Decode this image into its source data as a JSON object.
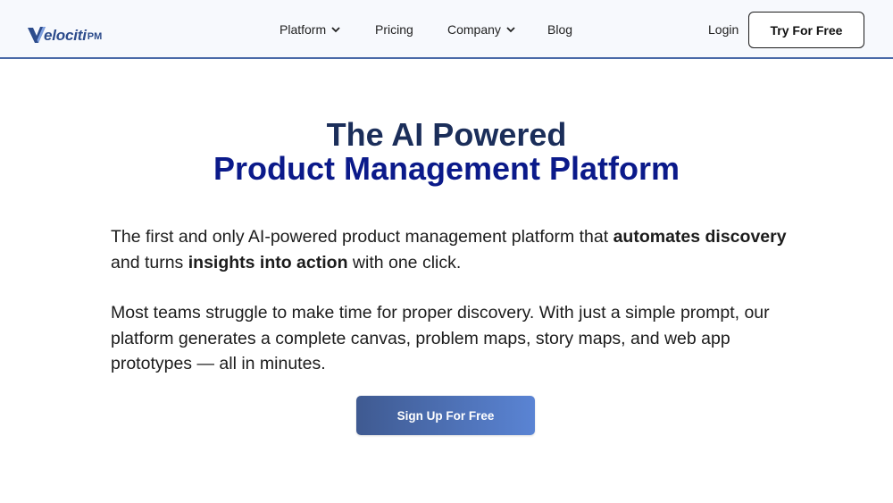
{
  "nav": {
    "logo_main": "elociti",
    "logo_suffix": "PM",
    "items": [
      {
        "label": "Platform",
        "has_dropdown": true
      },
      {
        "label": "Pricing",
        "has_dropdown": false
      },
      {
        "label": "Company",
        "has_dropdown": true
      },
      {
        "label": "Blog",
        "has_dropdown": false
      }
    ],
    "login": "Login",
    "cta": "Try For Free"
  },
  "hero": {
    "title_line1": "The AI Powered",
    "title_line2": "Product Management Platform",
    "p1": {
      "t1": "The first and only AI-powered product management platform that ",
      "b1": "automates discovery",
      "t2": " and turns ",
      "b2": "insights into action",
      "t3": " with one click."
    },
    "p2": "Most teams struggle to make time for proper discovery. With just a simple prompt, our platform generates a complete canvas, problem maps, story maps, and web app prototypes — all in minutes.",
    "cta": "Sign Up For Free"
  },
  "colors": {
    "nav_bg": "#f7f9fd",
    "nav_border": "#4a6aa8",
    "title_dark": "#1b2e5a",
    "title_blue": "#0b1a8a",
    "cta_gradient_start": "#3f5a91",
    "cta_gradient_end": "#5a84d4"
  }
}
